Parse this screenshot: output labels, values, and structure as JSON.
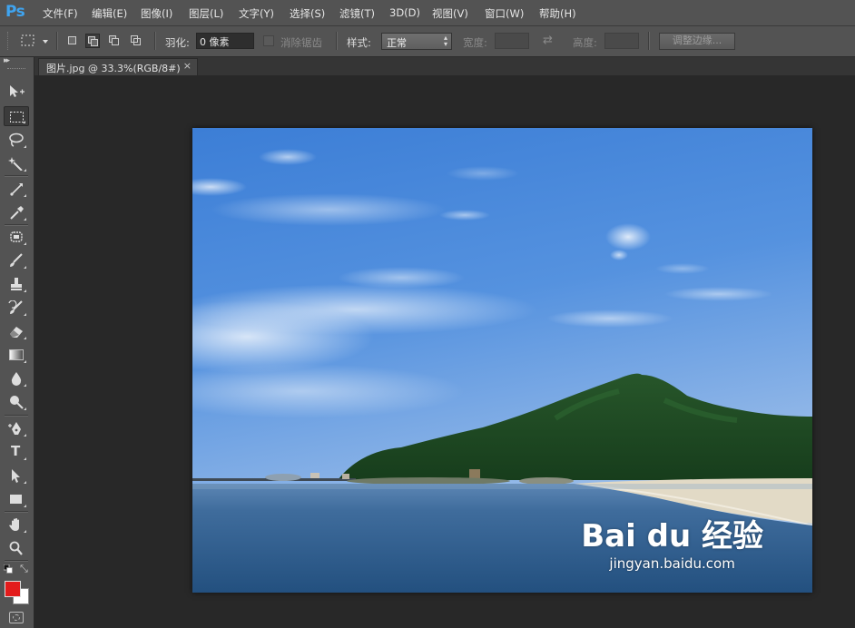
{
  "app": {
    "logo": "Ps"
  },
  "menu": [
    {
      "label": "文件(F)"
    },
    {
      "label": "编辑(E)"
    },
    {
      "label": "图像(I)"
    },
    {
      "label": "图层(L)"
    },
    {
      "label": "文字(Y)"
    },
    {
      "label": "选择(S)"
    },
    {
      "label": "滤镜(T)"
    },
    {
      "label": "3D(D)"
    },
    {
      "label": "视图(V)"
    },
    {
      "label": "窗口(W)"
    },
    {
      "label": "帮助(H)"
    }
  ],
  "options": {
    "feather_label": "羽化:",
    "feather_value": "0 像素",
    "antialias_label": "消除锯齿",
    "style_label": "样式:",
    "style_value": "正常",
    "width_label": "宽度:",
    "height_label": "高度:",
    "refine_edge_label": "调整边缘..."
  },
  "document": {
    "tab_title": "图片.jpg @ 33.3%(RGB/8#)",
    "close_glyph": "×"
  },
  "toolbar": {
    "active_tool": "rectangular-marquee",
    "type_tool_glyph": "T",
    "foreground_color": "#e31b1b",
    "background_color": "#ffffff"
  },
  "watermark": {
    "logo_text": "Bai du 经验",
    "url": "jingyan.baidu.com"
  }
}
